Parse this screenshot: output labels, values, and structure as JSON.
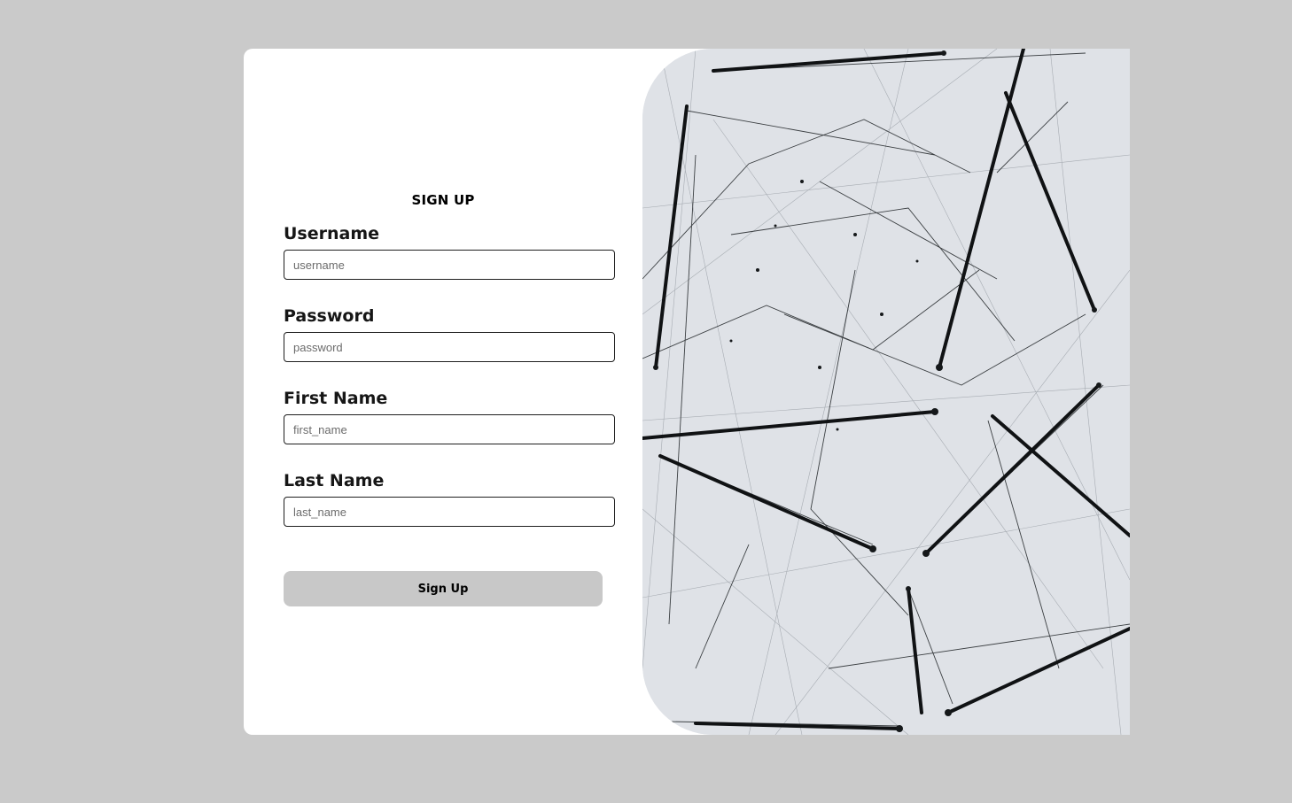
{
  "form": {
    "title": "SIGN UP",
    "fields": [
      {
        "label": "Username",
        "placeholder": "username"
      },
      {
        "label": "Password",
        "placeholder": "password"
      },
      {
        "label": "First Name",
        "placeholder": "first_name"
      },
      {
        "label": "Last Name",
        "placeholder": "last_name"
      }
    ],
    "submit_label": "Sign Up"
  },
  "colors": {
    "page_background": "#cacaca",
    "card_background": "#ffffff",
    "button_background": "#c8c8c8",
    "image_background": "#dfe2e7"
  }
}
